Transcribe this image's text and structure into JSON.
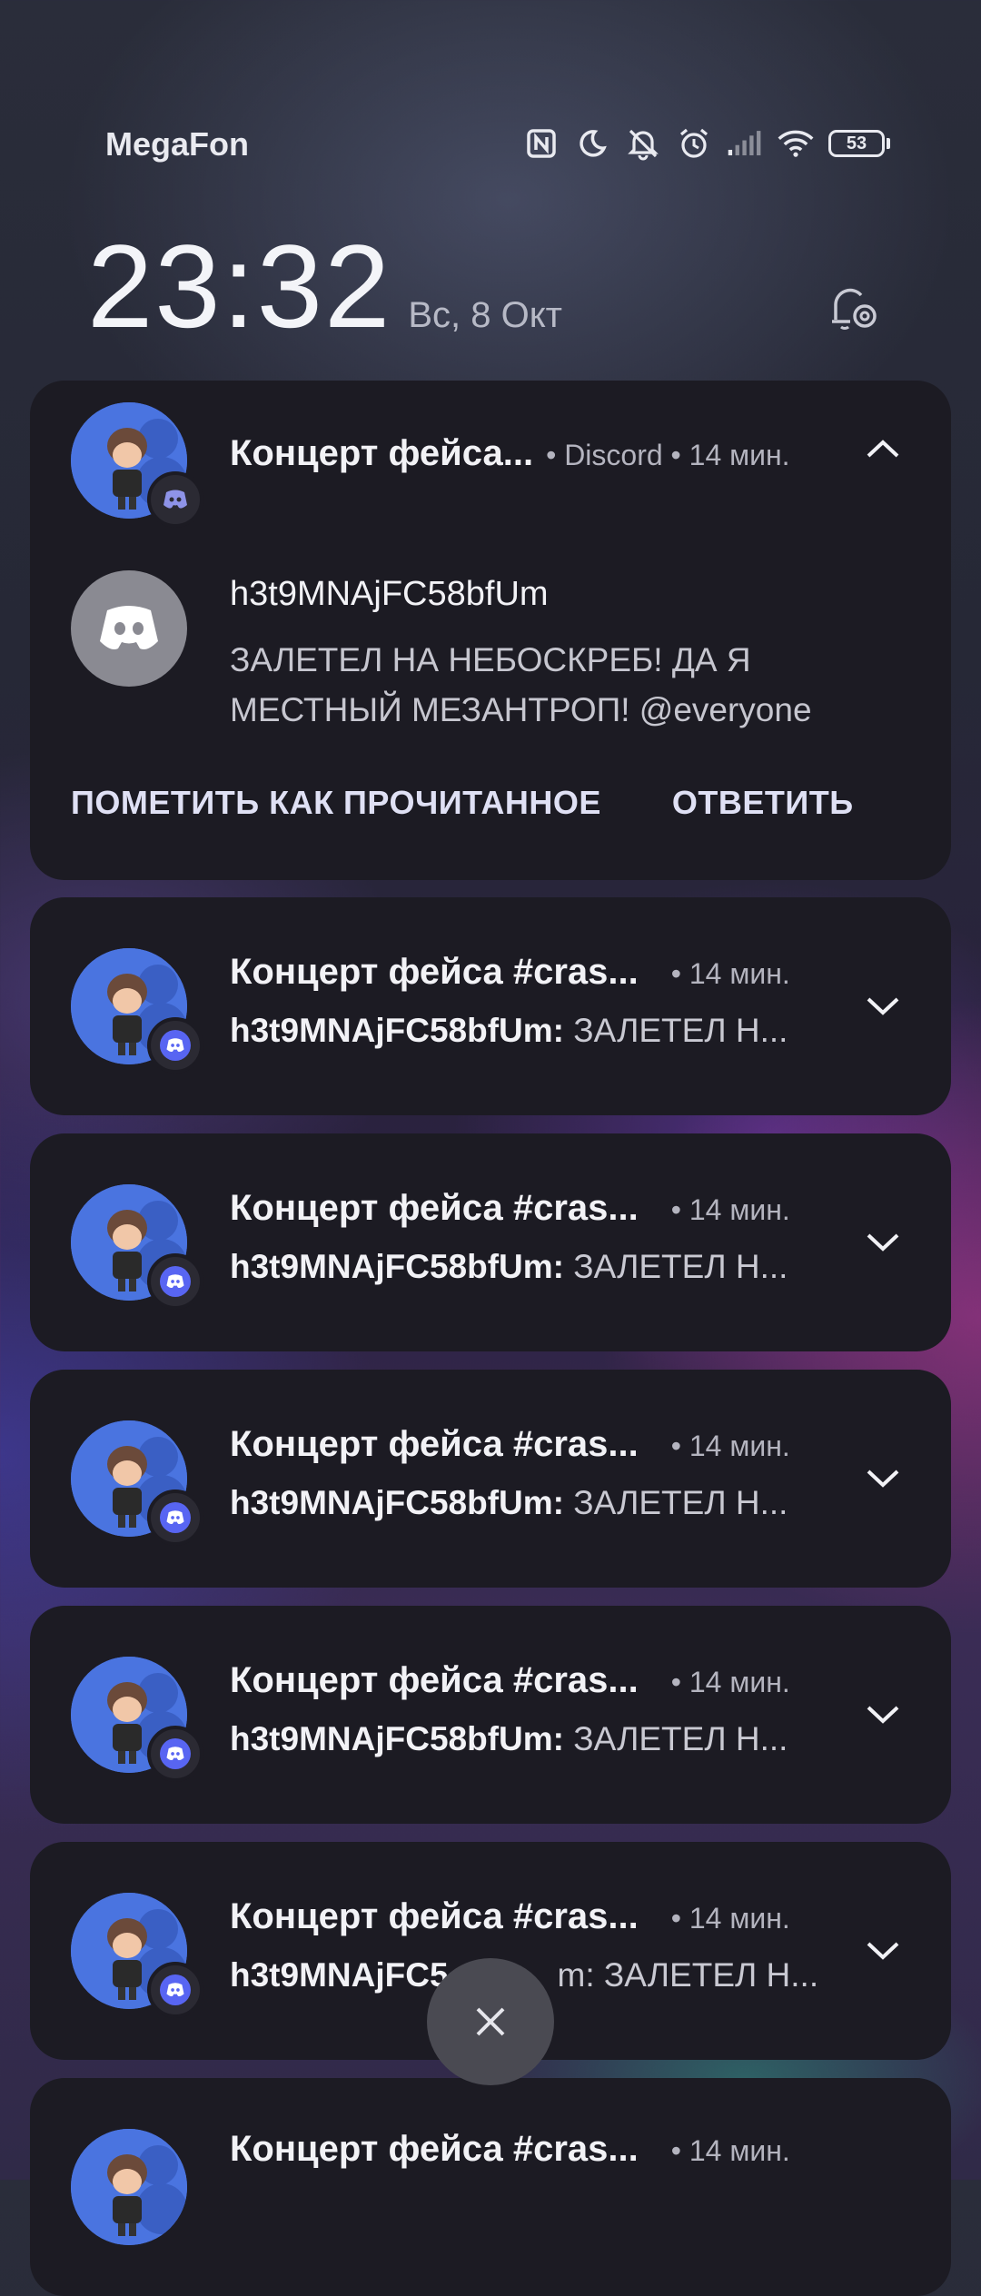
{
  "status_bar": {
    "carrier": "MegaFon",
    "battery": "53",
    "icons": [
      "nfc-icon",
      "moon-icon",
      "muted-bell-icon",
      "alarm-icon",
      "signal-icon",
      "wifi-icon",
      "battery-icon"
    ]
  },
  "lockscreen": {
    "time": "23:32",
    "date": "Вс, 8 Окт"
  },
  "expanded_notification": {
    "title": "Концерт фейса...",
    "app": "• Discord • 14 мин.",
    "sender": "h3t9MNAjFC58bfUm",
    "message": "ЗАЛЕТЕЛ НА НЕБОСКРЕБ! ДА Я МЕСТНЫЙ МЕЗАНТРОП! @everyone",
    "actions": {
      "mark_read": "ПОМЕТИТЬ КАК ПРОЧИТАННОЕ",
      "reply": "ОТВЕТИТЬ"
    }
  },
  "collapsed_notifications": [
    {
      "title": "Концерт фейса #cras...",
      "time": "• 14 мин.",
      "sender": "h3t9MNAjFC58bfUm:",
      "preview": "ЗАЛЕТЕЛ Н..."
    },
    {
      "title": "Концерт фейса #cras...",
      "time": "• 14 мин.",
      "sender": "h3t9MNAjFC58bfUm:",
      "preview": "ЗАЛЕТЕЛ Н..."
    },
    {
      "title": "Концерт фейса #cras...",
      "time": "• 14 мин.",
      "sender": "h3t9MNAjFC58bfUm:",
      "preview": "ЗАЛЕТЕЛ Н..."
    },
    {
      "title": "Концерт фейса #cras...",
      "time": "• 14 мин.",
      "sender": "h3t9MNAjFC58bfUm:",
      "preview": "ЗАЛЕТЕЛ Н..."
    },
    {
      "title": "Концерт фейса #cras...",
      "time": "• 14 мин.",
      "sender": "h3t9MNAjFC5",
      "preview": "m: ЗАЛЕТЕЛ Н..."
    },
    {
      "title": "Концерт фейса #cras...",
      "time": "• 14 мин.",
      "sender": "",
      "preview": ""
    }
  ],
  "colors": {
    "card_bg": "#1c1b23",
    "discord_blurple": "#5865F2",
    "avatar_blue": "#4a74e0"
  }
}
